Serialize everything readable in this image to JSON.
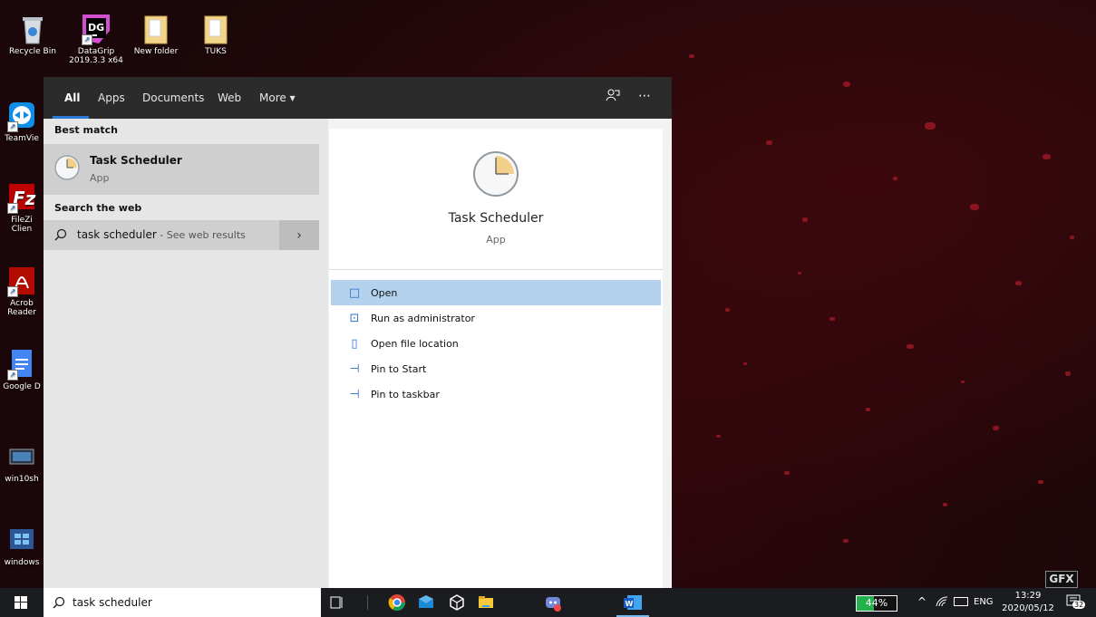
{
  "desktop": {
    "icons": [
      {
        "name": "recycle-bin",
        "label": "Recycle Bin"
      },
      {
        "name": "datagrip",
        "label": "DataGrip",
        "sublabel": "2019.3.3 x64"
      },
      {
        "name": "new-folder",
        "label": "New folder"
      },
      {
        "name": "tuks-folder",
        "label": "TUKS"
      },
      {
        "name": "teamviewer",
        "label": "TeamVie"
      },
      {
        "name": "filezilla",
        "label": "FileZi",
        "sublabel": "Clien"
      },
      {
        "name": "acrobat",
        "label": "Acrob",
        "sublabel": "Reader"
      },
      {
        "name": "google-docs",
        "label": "Google D"
      },
      {
        "name": "win10sh",
        "label": "win10sh"
      },
      {
        "name": "windows",
        "label": "windows"
      }
    ],
    "badge": "GFX"
  },
  "search": {
    "tabs": [
      "All",
      "Apps",
      "Documents",
      "Web",
      "More ▾"
    ],
    "active_tab": "All",
    "feedback_icon": "feedback-icon",
    "more_icon": "⋯",
    "best_match_label": "Best match",
    "best_match": {
      "title": "Task Scheduler",
      "subtitle": "App"
    },
    "web_label": "Search the web",
    "web_result": {
      "query": "task scheduler",
      "suffix": " - See web results"
    },
    "preview": {
      "title": "Task Scheduler",
      "subtitle": "App"
    },
    "actions": [
      {
        "label": "Open",
        "icon": "open-icon"
      },
      {
        "label": "Run as administrator",
        "icon": "shield-run-icon"
      },
      {
        "label": "Open file location",
        "icon": "file-location-icon"
      },
      {
        "label": "Pin to Start",
        "icon": "pin-icon"
      },
      {
        "label": "Pin to taskbar",
        "icon": "pin-icon"
      }
    ],
    "input_value": "task scheduler"
  },
  "taskbar": {
    "battery": "44%",
    "lang": "ENG",
    "time": "13:29",
    "date": "2020/05/12",
    "notifications": "32",
    "colors": {
      "accent": "#2b7bd6",
      "battery": "#22b14c"
    }
  }
}
